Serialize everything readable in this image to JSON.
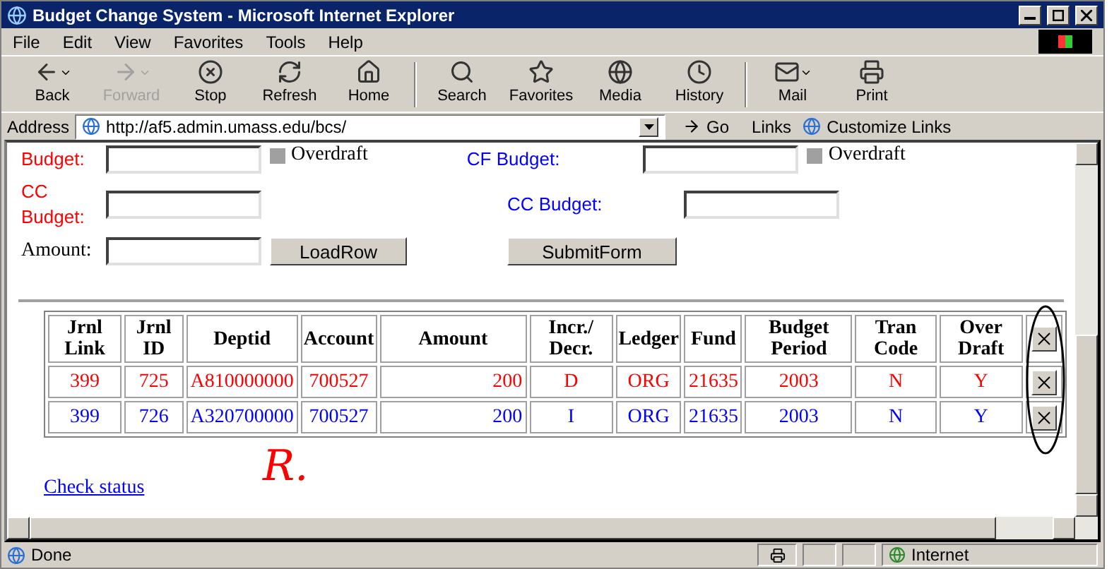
{
  "window": {
    "title": "Budget Change System - Microsoft Internet Explorer"
  },
  "menu": [
    "File",
    "Edit",
    "View",
    "Favorites",
    "Tools",
    "Help"
  ],
  "toolbar": [
    {
      "kind": "back",
      "label": "Back",
      "disabled": false,
      "dropdown": true
    },
    {
      "kind": "forward",
      "label": "Forward",
      "disabled": true,
      "dropdown": true
    },
    {
      "kind": "stop",
      "label": "Stop",
      "disabled": false,
      "dropdown": false
    },
    {
      "kind": "refresh",
      "label": "Refresh",
      "disabled": false,
      "dropdown": false
    },
    {
      "kind": "home",
      "label": "Home",
      "disabled": false,
      "dropdown": false
    },
    {
      "kind": "search",
      "label": "Search",
      "disabled": false,
      "dropdown": false
    },
    {
      "kind": "favorites",
      "label": "Favorites",
      "disabled": false,
      "dropdown": false
    },
    {
      "kind": "media",
      "label": "Media",
      "disabled": false,
      "dropdown": false
    },
    {
      "kind": "history",
      "label": "History",
      "disabled": false,
      "dropdown": false
    },
    {
      "kind": "mail",
      "label": "Mail",
      "disabled": false,
      "dropdown": true
    },
    {
      "kind": "print",
      "label": "Print",
      "disabled": false,
      "dropdown": false
    }
  ],
  "address": {
    "label": "Address",
    "value": "http://af5.admin.umass.edu/bcs/",
    "go": "Go",
    "links": "Links",
    "customize": "Customize Links"
  },
  "form": {
    "budget_label": "Budget:",
    "overdraft_left": {
      "label": "Overdraft",
      "checked": false
    },
    "cf_budget_label": "CF Budget:",
    "overdraft_right": {
      "label": "Overdraft",
      "checked": false
    },
    "cc_budget_left": "CC Budget:",
    "cc_budget_right": "CC Budget:",
    "amount_label": "Amount:",
    "load_button": "LoadRow",
    "submit_button": "SubmitForm"
  },
  "table": {
    "columns": [
      "Jrnl Link",
      "Jrnl ID",
      "Deptid",
      "Account",
      "Amount",
      "Incr./ Decr.",
      "Ledger",
      "Fund",
      "Budget Period",
      "Tran Code",
      "Over Draft"
    ],
    "rows": [
      {
        "color": "#ff0000",
        "cells": [
          "399",
          "725",
          "A810000000",
          "700527",
          "200",
          "D",
          "ORG",
          "21635",
          "2003",
          "N",
          "Y"
        ]
      },
      {
        "color": "#0000ff",
        "cells": [
          "399",
          "726",
          "A320700000",
          "700527",
          "200",
          "I",
          "ORG",
          "21635",
          "2003",
          "N",
          "Y"
        ]
      }
    ]
  },
  "annotation": "R.",
  "link": "Check status",
  "status": {
    "text": "Done",
    "zone": "Internet"
  }
}
